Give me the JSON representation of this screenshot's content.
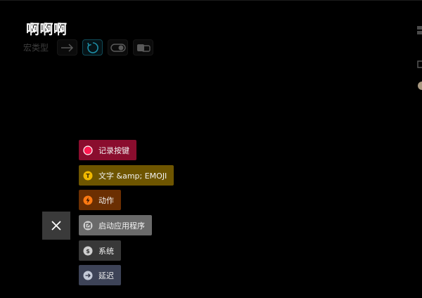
{
  "title": "啊啊啊",
  "macro_type": {
    "label": "宏类型",
    "options": [
      {
        "name": "arrow-right-icon",
        "active": false
      },
      {
        "name": "repeat-circle-icon",
        "active": true
      },
      {
        "name": "toggle-icon",
        "active": false
      },
      {
        "name": "hold-key-icon",
        "active": false
      }
    ]
  },
  "menu": {
    "items": [
      {
        "label": "记录按键",
        "icon": "record-icon",
        "color": "#8a0d2e",
        "icon_color": "#ff1850"
      },
      {
        "label": "文字 &amp; EMOJI",
        "icon": "text-icon",
        "color": "#6e5500",
        "icon_color": "#f0b900"
      },
      {
        "label": "动作",
        "icon": "bolt-icon",
        "color": "#6b2f02",
        "icon_color": "#ff7a12"
      },
      {
        "label": "启动应用程序",
        "icon": "launch-app-icon",
        "color": "#6a6a6a",
        "icon_color": "#cfcfcf"
      },
      {
        "label": "系统",
        "icon": "system-icon",
        "color": "#383838",
        "icon_color": "#cfcfcf"
      },
      {
        "label": "延迟",
        "icon": "delay-icon",
        "color": "#3d4357",
        "icon_color": "#c4cad8"
      }
    ]
  },
  "close_icon": "close-icon"
}
